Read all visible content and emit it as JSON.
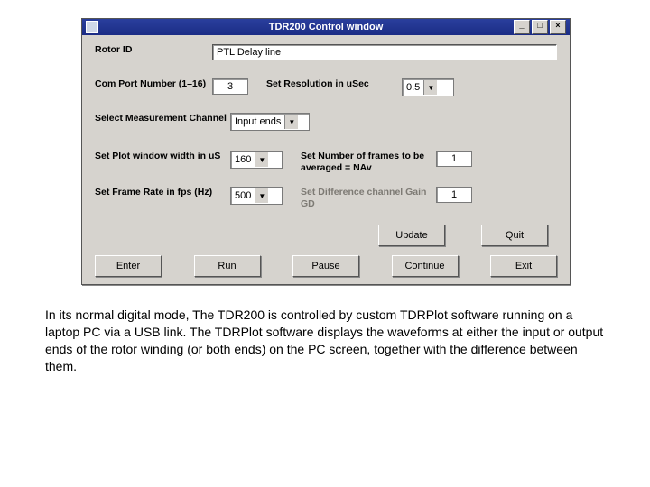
{
  "titlebar": {
    "title": "TDR200 Control window",
    "min": "_",
    "max": "□",
    "close": "×"
  },
  "labels": {
    "rotor_id": "Rotor ID",
    "com_port": "Com Port Number (1–16)",
    "resolution": "Set Resolution in uSec",
    "channel": "Select Measurement Channel",
    "plot_width": "Set Plot window width in uS",
    "frames_avg": "Set Number of frames to be averaged = NAv",
    "frame_rate": "Set Frame Rate in fps (Hz)",
    "diff_gain": "Set Difference channel Gain GD"
  },
  "values": {
    "rotor_id": "PTL Delay line",
    "com_port": "3",
    "resolution": "0.5",
    "channel": "Input ends",
    "plot_width": "160",
    "frames_avg": "1",
    "frame_rate": "500",
    "diff_gain": "1"
  },
  "buttons": {
    "update": "Update",
    "quit": "Quit",
    "enter": "Enter",
    "run": "Run",
    "pause": "Pause",
    "continue": "Continue",
    "exit": "Exit"
  },
  "caption": "In its normal digital mode, The TDR200 is controlled by custom TDRPlot software running on a laptop PC via a USB link. The TDRPlot software displays the waveforms at either the input or output ends of the rotor winding (or both ends) on the PC screen, together with the difference between them."
}
